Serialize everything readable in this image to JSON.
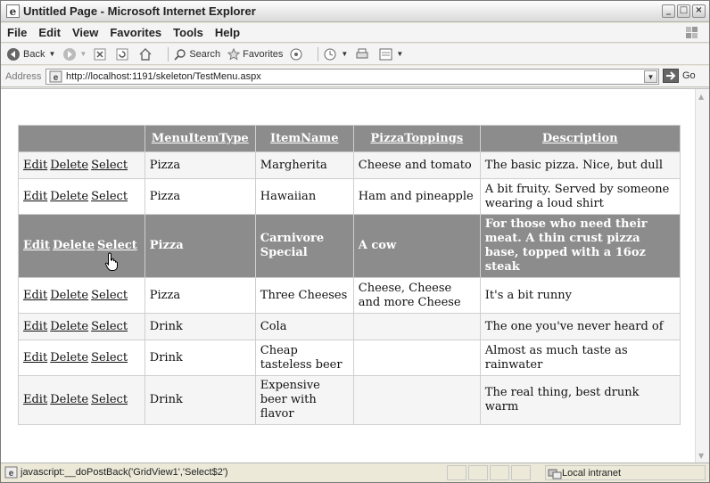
{
  "window": {
    "title": "Untitled Page - Microsoft Internet Explorer",
    "buttons": [
      "_",
      "□",
      "×"
    ]
  },
  "menu": [
    "File",
    "Edit",
    "View",
    "Favorites",
    "Tools",
    "Help"
  ],
  "toolbar": {
    "back_label": "Back",
    "search_label": "Search",
    "favorites_label": "Favorites"
  },
  "address": {
    "label": "Address",
    "url": "http://localhost:1191/skeleton/TestMenu.aspx",
    "go_label": "Go"
  },
  "grid": {
    "headers": [
      "",
      "MenuItemType",
      "ItemName",
      "PizzaToppings",
      "Description"
    ],
    "command_labels": [
      "Edit",
      "Delete",
      "Select"
    ],
    "selected_row_index": 2,
    "rows": [
      {
        "type": "Pizza",
        "name": "Margherita",
        "toppings": "Cheese and tomato",
        "description": "The basic pizza. Nice, but dull"
      },
      {
        "type": "Pizza",
        "name": "Hawaiian",
        "toppings": "Ham and pineapple",
        "description": "A bit fruity. Served by someone wearing a loud shirt"
      },
      {
        "type": "Pizza",
        "name": "Carnivore Special",
        "toppings": "A cow",
        "description": "For those who need their meat. A thin crust pizza base, topped with a 16oz steak"
      },
      {
        "type": "Pizza",
        "name": "Three Cheeses",
        "toppings": "Cheese, Cheese and more Cheese",
        "description": "It's a bit runny"
      },
      {
        "type": "Drink",
        "name": "Cola",
        "toppings": "",
        "description": "The one you've never heard of"
      },
      {
        "type": "Drink",
        "name": "Cheap tasteless beer",
        "toppings": "",
        "description": "Almost as much taste as rainwater"
      },
      {
        "type": "Drink",
        "name": "Expensive beer with flavor",
        "toppings": "",
        "description": "The real thing, best drunk warm"
      }
    ]
  },
  "status": {
    "message": "javascript:__doPostBack('GridView1','Select$2')",
    "zone": "Local intranet"
  }
}
